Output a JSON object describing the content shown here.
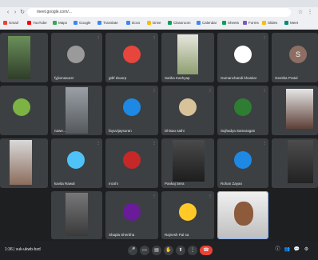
{
  "browser": {
    "url": "meet.google.com/...",
    "bookmarks": [
      "Gmail",
      "YouTube",
      "Maps",
      "Google",
      "Translate",
      "Docs",
      "Drive",
      "Classroom",
      "Calendar",
      "Sheets",
      "Forms",
      "Slides",
      "Meet"
    ]
  },
  "tiles": [
    {
      "name": "",
      "initial": "",
      "kind": "video"
    },
    {
      "name": "fyjlomasurer",
      "kind": "avatar",
      "color": "#9a9a9a",
      "initial": ""
    },
    {
      "name": "gtbf dsusrp",
      "kind": "avatar",
      "color": "#e8453c",
      "initial": ""
    },
    {
      "name": "Sarika Kashyap",
      "kind": "video"
    },
    {
      "name": "Gumanchandi bhaskar",
      "kind": "avatar",
      "color": "#ffffff",
      "initial": ""
    },
    {
      "name": "Geetika Pratul",
      "kind": "avatar",
      "color": "#8d6e63",
      "initial": "S"
    },
    {
      "name": "",
      "kind": "avatar",
      "color": "#7cb342",
      "initial": ""
    },
    {
      "name": "nawe...",
      "kind": "video"
    },
    {
      "name": "fayuvijaysuran",
      "kind": "avatar",
      "color": "#1e88e5",
      "initial": ""
    },
    {
      "name": "Dhisao sathi",
      "kind": "avatar",
      "color": "#d7c29a",
      "initial": ""
    },
    {
      "name": "Sujhadya Samaragan",
      "kind": "avatar",
      "color": "#2e7d32",
      "initial": ""
    },
    {
      "name": "",
      "kind": "video"
    },
    {
      "name": "",
      "kind": "video"
    },
    {
      "name": "kavita Rawal",
      "kind": "avatar",
      "color": "#4fc3f7",
      "initial": ""
    },
    {
      "name": "mcshi",
      "kind": "avatar",
      "color": "#c62828",
      "initial": ""
    },
    {
      "name": "Pankaj Sera",
      "kind": "video"
    },
    {
      "name": "Rohan Zayan",
      "kind": "avatar",
      "color": "#1e88e5",
      "initial": ""
    },
    {
      "name": "",
      "kind": "video"
    },
    {
      "name": "",
      "kind": "video"
    },
    {
      "name": "Shapla Sherbha",
      "kind": "avatar",
      "color": "#6a1b9a",
      "initial": ""
    },
    {
      "name": "Rajnesh Pal sa",
      "kind": "avatar",
      "color": "#ffca28",
      "initial": ""
    },
    {
      "name": "",
      "kind": "video"
    }
  ],
  "meeting": {
    "time": "1:36 | vuk-ukwb-bzd"
  }
}
